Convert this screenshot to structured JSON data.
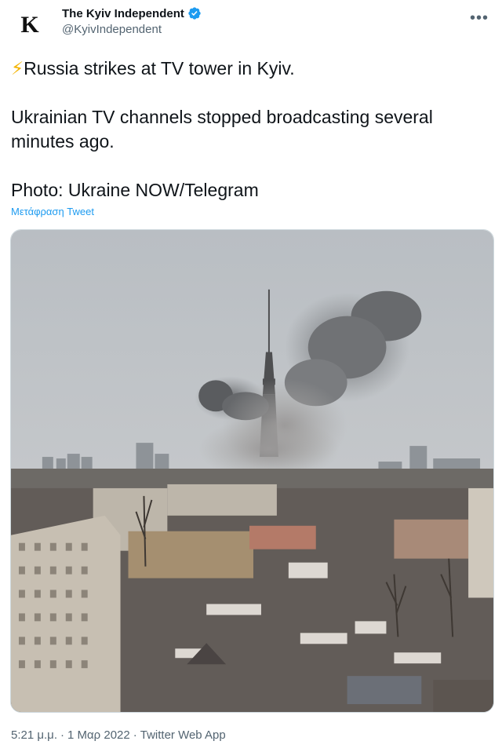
{
  "author": {
    "avatar_letter": "K",
    "display_name": "The Kyiv Independent",
    "handle": "@KyivIndependent",
    "verified_color": "#1d9bf0"
  },
  "tweet": {
    "bolt_glyph": "⚡",
    "line1": "Russia strikes at TV tower in Kyiv.",
    "line2": "Ukrainian TV channels stopped broadcasting several minutes ago.",
    "line3": "Photo: Ukraine NOW/Telegram",
    "translate_label": "Μετάφραση Tweet"
  },
  "meta": {
    "time": "5:21 μ.μ.",
    "separator1": "·",
    "date": "1 Μαρ 2022",
    "separator2": "·",
    "source": "Twitter Web App"
  },
  "colors": {
    "accent": "#1d9bf0",
    "secondary_text": "#536471",
    "text": "#0f1419"
  },
  "media": {
    "description_icon": "photo-of-smoke-over-tv-tower"
  }
}
